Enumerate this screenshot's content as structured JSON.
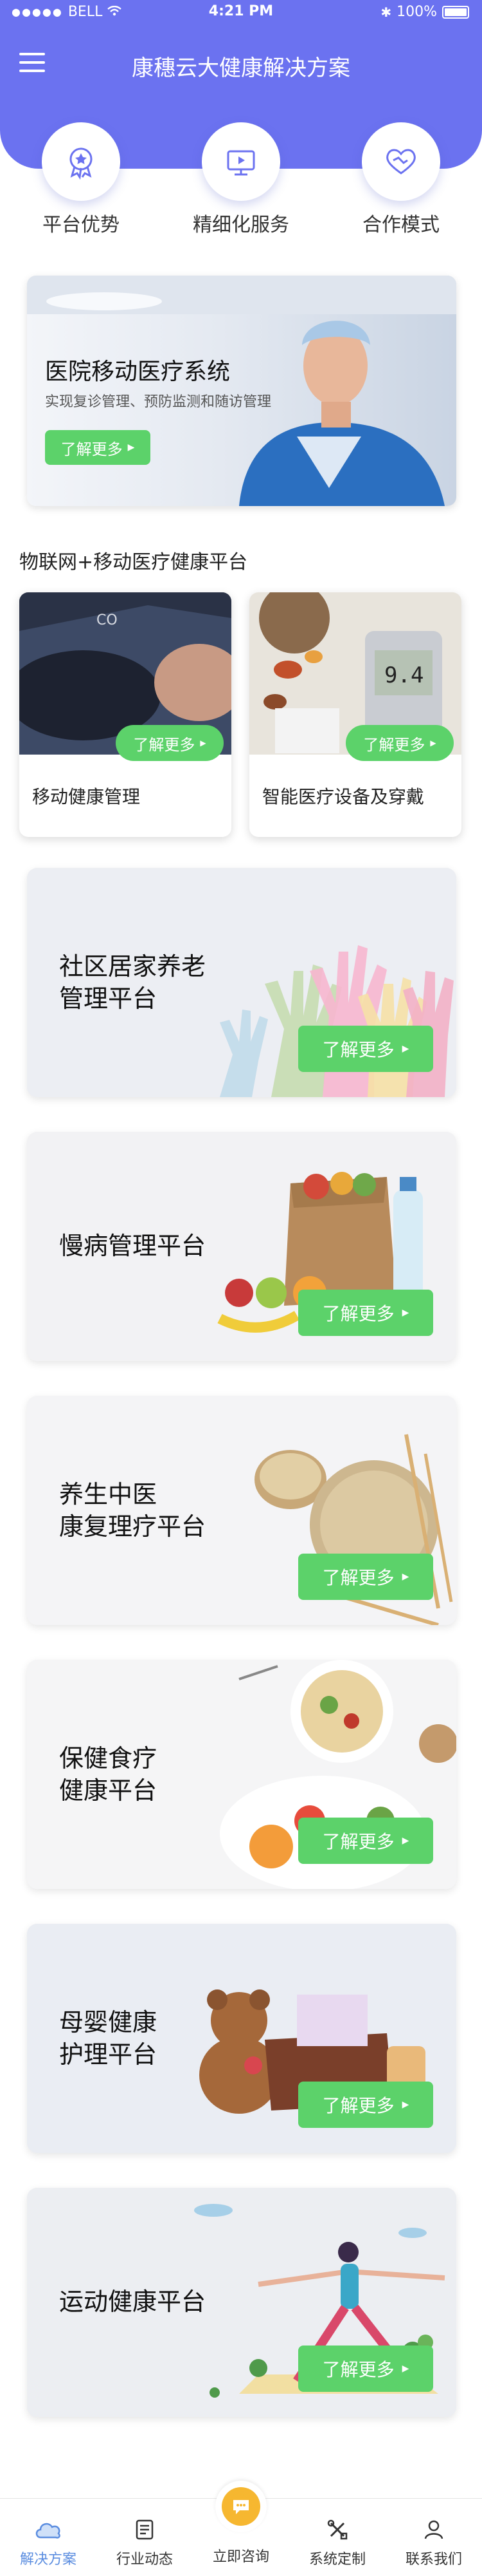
{
  "status_bar": {
    "carrier": "BELL",
    "time": "4:21 PM",
    "battery": "100%"
  },
  "header": {
    "title": "康穗云大健康解决方案"
  },
  "top_nav": [
    {
      "label": "平台优势",
      "icon": "award-icon"
    },
    {
      "label": "精细化服务",
      "icon": "presentation-icon"
    },
    {
      "label": "合作模式",
      "icon": "handshake-icon"
    }
  ],
  "banner": {
    "title": "医院移动医疗系统",
    "subtitle": "实现复诊管理、预防监测和随访管理",
    "button": "了解更多"
  },
  "iot_section": {
    "title": "物联网+移动医疗健康平台",
    "cards": [
      {
        "label": "移动健康管理",
        "button": "了解更多"
      },
      {
        "label": "智能医疗设备及穿戴",
        "button": "了解更多"
      }
    ]
  },
  "platforms": [
    {
      "line1": "社区居家养老",
      "line2": "管理平台",
      "button": "了解更多"
    },
    {
      "line1": "慢病管理平台",
      "line2": "",
      "button": "了解更多"
    },
    {
      "line1": "养生中医",
      "line2": "康复理疗平台",
      "button": "了解更多"
    },
    {
      "line1": "保健食疗",
      "line2": "健康平台",
      "button": "了解更多"
    },
    {
      "line1": "母婴健康",
      "line2": "护理平台",
      "button": "了解更多"
    },
    {
      "line1": "运动健康平台",
      "line2": "",
      "button": "了解更多"
    }
  ],
  "tabbar": [
    {
      "label": "解决方案",
      "icon": "cloud-icon",
      "active": true
    },
    {
      "label": "行业动态",
      "icon": "document-icon",
      "active": false
    },
    {
      "label": "立即咨询",
      "icon": "chat-icon",
      "active": false
    },
    {
      "label": "系统定制",
      "icon": "tools-icon",
      "active": false
    },
    {
      "label": "联系我们",
      "icon": "user-icon",
      "active": false
    }
  ],
  "colors": {
    "primary": "#6b72f0",
    "button_green": "#5cd26a",
    "consult": "#f6b730",
    "active_tab": "#5b8de0"
  }
}
